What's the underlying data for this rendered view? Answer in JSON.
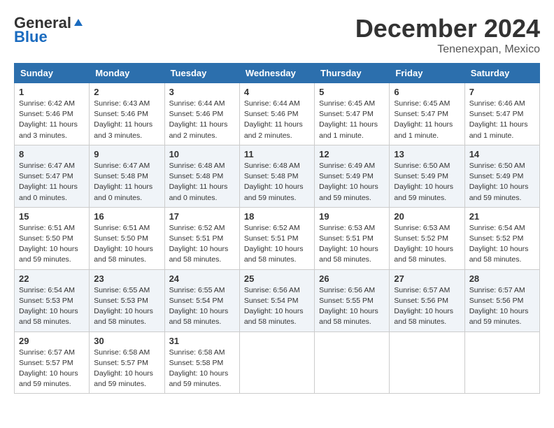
{
  "header": {
    "logo_general": "General",
    "logo_blue": "Blue",
    "month_title": "December 2024",
    "location": "Tenenexpan, Mexico"
  },
  "weekdays": [
    "Sunday",
    "Monday",
    "Tuesday",
    "Wednesday",
    "Thursday",
    "Friday",
    "Saturday"
  ],
  "weeks": [
    [
      {
        "day": "1",
        "sunrise": "6:42 AM",
        "sunset": "5:46 PM",
        "daylight": "11 hours and 3 minutes."
      },
      {
        "day": "2",
        "sunrise": "6:43 AM",
        "sunset": "5:46 PM",
        "daylight": "11 hours and 3 minutes."
      },
      {
        "day": "3",
        "sunrise": "6:44 AM",
        "sunset": "5:46 PM",
        "daylight": "11 hours and 2 minutes."
      },
      {
        "day": "4",
        "sunrise": "6:44 AM",
        "sunset": "5:46 PM",
        "daylight": "11 hours and 2 minutes."
      },
      {
        "day": "5",
        "sunrise": "6:45 AM",
        "sunset": "5:47 PM",
        "daylight": "11 hours and 1 minute."
      },
      {
        "day": "6",
        "sunrise": "6:45 AM",
        "sunset": "5:47 PM",
        "daylight": "11 hours and 1 minute."
      },
      {
        "day": "7",
        "sunrise": "6:46 AM",
        "sunset": "5:47 PM",
        "daylight": "11 hours and 1 minute."
      }
    ],
    [
      {
        "day": "8",
        "sunrise": "6:47 AM",
        "sunset": "5:47 PM",
        "daylight": "11 hours and 0 minutes."
      },
      {
        "day": "9",
        "sunrise": "6:47 AM",
        "sunset": "5:48 PM",
        "daylight": "11 hours and 0 minutes."
      },
      {
        "day": "10",
        "sunrise": "6:48 AM",
        "sunset": "5:48 PM",
        "daylight": "11 hours and 0 minutes."
      },
      {
        "day": "11",
        "sunrise": "6:48 AM",
        "sunset": "5:48 PM",
        "daylight": "10 hours and 59 minutes."
      },
      {
        "day": "12",
        "sunrise": "6:49 AM",
        "sunset": "5:49 PM",
        "daylight": "10 hours and 59 minutes."
      },
      {
        "day": "13",
        "sunrise": "6:50 AM",
        "sunset": "5:49 PM",
        "daylight": "10 hours and 59 minutes."
      },
      {
        "day": "14",
        "sunrise": "6:50 AM",
        "sunset": "5:49 PM",
        "daylight": "10 hours and 59 minutes."
      }
    ],
    [
      {
        "day": "15",
        "sunrise": "6:51 AM",
        "sunset": "5:50 PM",
        "daylight": "10 hours and 59 minutes."
      },
      {
        "day": "16",
        "sunrise": "6:51 AM",
        "sunset": "5:50 PM",
        "daylight": "10 hours and 58 minutes."
      },
      {
        "day": "17",
        "sunrise": "6:52 AM",
        "sunset": "5:51 PM",
        "daylight": "10 hours and 58 minutes."
      },
      {
        "day": "18",
        "sunrise": "6:52 AM",
        "sunset": "5:51 PM",
        "daylight": "10 hours and 58 minutes."
      },
      {
        "day": "19",
        "sunrise": "6:53 AM",
        "sunset": "5:51 PM",
        "daylight": "10 hours and 58 minutes."
      },
      {
        "day": "20",
        "sunrise": "6:53 AM",
        "sunset": "5:52 PM",
        "daylight": "10 hours and 58 minutes."
      },
      {
        "day": "21",
        "sunrise": "6:54 AM",
        "sunset": "5:52 PM",
        "daylight": "10 hours and 58 minutes."
      }
    ],
    [
      {
        "day": "22",
        "sunrise": "6:54 AM",
        "sunset": "5:53 PM",
        "daylight": "10 hours and 58 minutes."
      },
      {
        "day": "23",
        "sunrise": "6:55 AM",
        "sunset": "5:53 PM",
        "daylight": "10 hours and 58 minutes."
      },
      {
        "day": "24",
        "sunrise": "6:55 AM",
        "sunset": "5:54 PM",
        "daylight": "10 hours and 58 minutes."
      },
      {
        "day": "25",
        "sunrise": "6:56 AM",
        "sunset": "5:54 PM",
        "daylight": "10 hours and 58 minutes."
      },
      {
        "day": "26",
        "sunrise": "6:56 AM",
        "sunset": "5:55 PM",
        "daylight": "10 hours and 58 minutes."
      },
      {
        "day": "27",
        "sunrise": "6:57 AM",
        "sunset": "5:56 PM",
        "daylight": "10 hours and 58 minutes."
      },
      {
        "day": "28",
        "sunrise": "6:57 AM",
        "sunset": "5:56 PM",
        "daylight": "10 hours and 59 minutes."
      }
    ],
    [
      {
        "day": "29",
        "sunrise": "6:57 AM",
        "sunset": "5:57 PM",
        "daylight": "10 hours and 59 minutes."
      },
      {
        "day": "30",
        "sunrise": "6:58 AM",
        "sunset": "5:57 PM",
        "daylight": "10 hours and 59 minutes."
      },
      {
        "day": "31",
        "sunrise": "6:58 AM",
        "sunset": "5:58 PM",
        "daylight": "10 hours and 59 minutes."
      },
      null,
      null,
      null,
      null
    ]
  ]
}
